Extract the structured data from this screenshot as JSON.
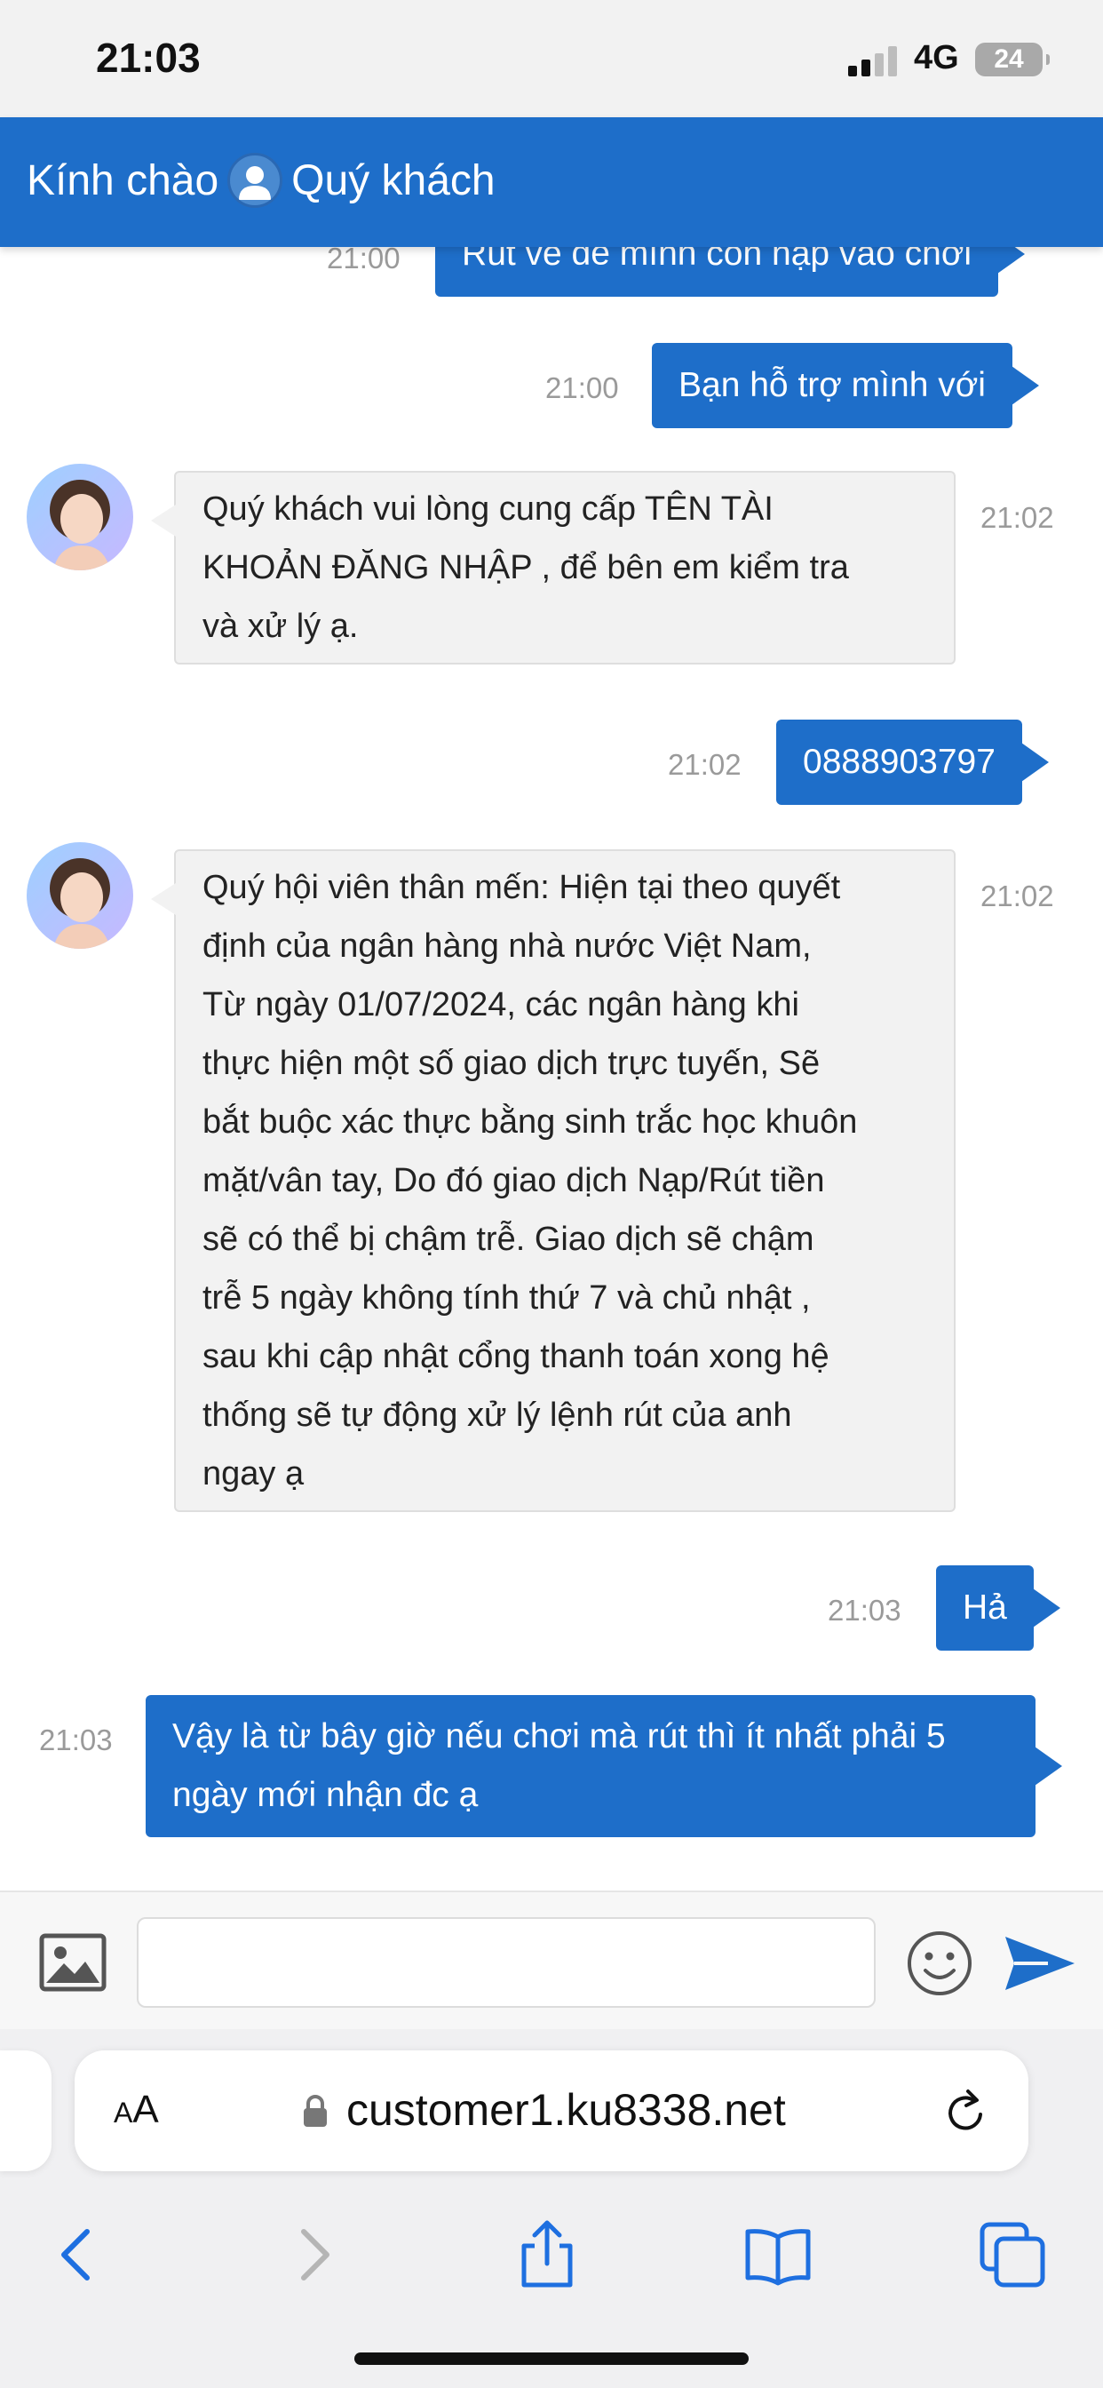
{
  "status_bar": {
    "time": "21:03",
    "network": "4G",
    "battery": "24"
  },
  "header": {
    "greeting_prefix": "Kính chào",
    "greeting_name": "Quý khách"
  },
  "messages": [
    {
      "direction": "outgoing",
      "time": "21:00",
      "text": "Rút về để mình còn nạp vào chơi"
    },
    {
      "direction": "outgoing",
      "time": "21:00",
      "text": "Bạn hỗ trợ mình với"
    },
    {
      "direction": "incoming",
      "time": "21:02",
      "lines": [
        "Quý khách vui lòng cung cấp TÊN TÀI",
        "KHOẢN ĐĂNG NHẬP , để bên em kiểm tra",
        "và xử lý ạ."
      ]
    },
    {
      "direction": "outgoing",
      "time": "21:02",
      "text": "0888903797"
    },
    {
      "direction": "incoming",
      "time": "21:02",
      "lines": [
        "Quý hội viên thân mến: Hiện tại theo quyết",
        "định của ngân hàng nhà nước Việt Nam,",
        "Từ ngày 01/07/2024, các ngân hàng khi",
        "thực hiện một số giao dịch trực tuyến, Sẽ",
        "bắt buộc xác thực bằng sinh trắc học khuôn",
        "mặt/vân tay, Do đó giao dịch Nạp/Rút tiền",
        "sẽ có thể bị chậm trễ. Giao dịch sẽ chậm",
        "trễ 5 ngày không tính thứ 7 và chủ nhật ,",
        "sau khi cập nhật cổng thanh toán xong hệ",
        "thống sẽ tự động xử lý lệnh rút của anh",
        "ngay ạ"
      ]
    },
    {
      "direction": "outgoing",
      "time": "21:03",
      "text": "Hả"
    },
    {
      "direction": "outgoing",
      "time": "21:03",
      "lines": [
        "Vậy là từ bây giờ nếu chơi mà rút thì ít nhất phải 5",
        "ngày mới nhận đc ạ"
      ]
    }
  ],
  "input_bar": {
    "image_icon": "image-icon",
    "emoji_icon": "emoji-icon",
    "send_icon": "send-icon",
    "message_value": ""
  },
  "browser": {
    "text_size_label_small": "A",
    "text_size_label_large": "A",
    "url": "customer1.ku8338.net",
    "icons": [
      "lock-icon",
      "reload-icon",
      "back-icon",
      "forward-icon",
      "share-icon",
      "bookmarks-icon",
      "tabs-icon"
    ]
  },
  "colors": {
    "brand_blue": "#1e6ec9",
    "incoming_bg": "#f2f2f2",
    "timestamp": "#9a9a9a"
  }
}
